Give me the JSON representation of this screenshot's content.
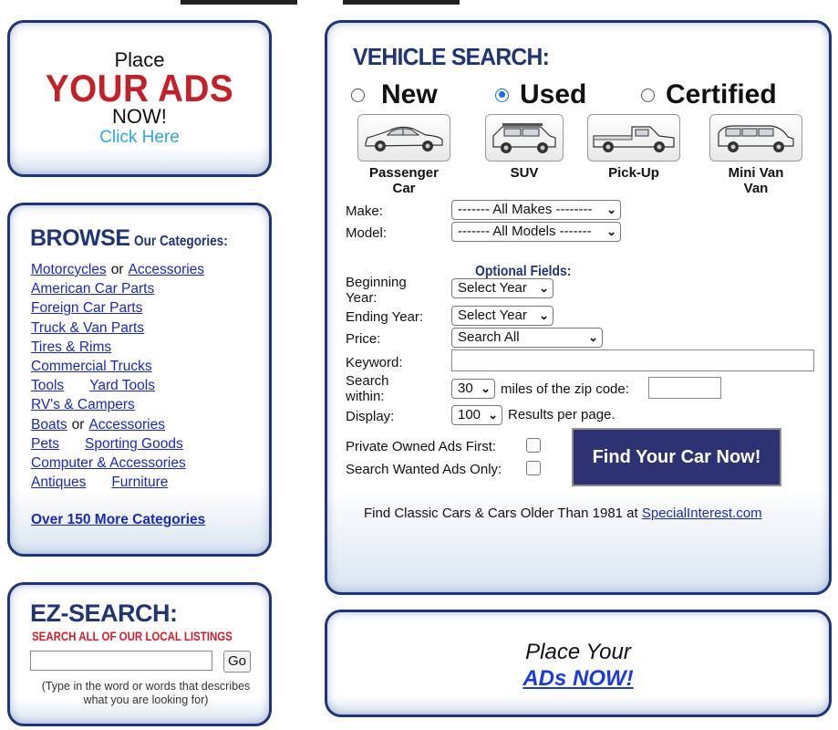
{
  "place_ads": {
    "place": "Place",
    "your_ads": "YOUR ADS",
    "now": "NOW!",
    "click": "Click Here"
  },
  "browse": {
    "title_big": "BROWSE",
    "title_small": "Our Categories:",
    "rows": [
      {
        "items": [
          "Motorcycles",
          "Accessories"
        ],
        "sep": "or"
      },
      {
        "items": [
          "American Car Parts"
        ]
      },
      {
        "items": [
          "Foreign Car Parts"
        ]
      },
      {
        "items": [
          "Truck & Van Parts"
        ]
      },
      {
        "items": [
          "Tires & Rims"
        ]
      },
      {
        "items": [
          "Commercial Trucks"
        ]
      },
      {
        "items": [
          "Tools",
          "Yard Tools"
        ]
      },
      {
        "items": [
          "RV's & Campers"
        ]
      },
      {
        "items": [
          "Boats",
          "Accessories"
        ],
        "sep": "or"
      },
      {
        "items": [
          "Pets",
          "Sporting Goods"
        ]
      },
      {
        "items": [
          "Computer & Accessories"
        ]
      },
      {
        "items": [
          "Antiques",
          "Furniture"
        ]
      }
    ],
    "more": "Over 150 More Categories"
  },
  "ez": {
    "title": "EZ-SEARCH:",
    "subtitle": "SEARCH ALL OF OUR LOCAL LISTINGS",
    "input_value": "",
    "go": "Go",
    "help": "(Type in the word or words that describes what you are looking for)"
  },
  "vehicle_search": {
    "title": "VEHICLE SEARCH:",
    "conditions": [
      {
        "label": "New",
        "selected": false
      },
      {
        "label": "Used",
        "selected": true
      },
      {
        "label": "Certified",
        "selected": false
      }
    ],
    "types": [
      {
        "label": "Passenger Car",
        "icon": "sedan-icon"
      },
      {
        "label": "SUV",
        "icon": "suv-icon"
      },
      {
        "label": "Pick-Up",
        "icon": "pickup-truck-icon"
      },
      {
        "label": "Mini Van Van",
        "icon": "minivan-icon"
      }
    ],
    "make_label": "Make:",
    "make_value": "------- All Makes --------",
    "model_label": "Model:",
    "model_value": "------- All Models -------",
    "optional": "Optional Fields:",
    "begin_year_label": "Beginning Year:",
    "begin_year_value": "Select Year",
    "end_year_label": "Ending Year:",
    "end_year_value": "Select Year",
    "price_label": "Price:",
    "price_value": "Search All",
    "keyword_label": "Keyword:",
    "keyword_value": "",
    "within_label": "Search within:",
    "within_value": "30",
    "miles_text": "miles of the zip code:",
    "zip_value": "",
    "display_label": "Display:",
    "display_value": "100",
    "results_text": "Results per page.",
    "private_label": "Private Owned Ads First:",
    "wanted_label": "Search Wanted Ads Only:",
    "find_button": "Find Your Car Now!",
    "classic_text": "Find Classic Cars & Cars Older Than 1981 at",
    "classic_link": "SpecialInterest.com"
  },
  "place_ads_2": {
    "line1": "Place Your",
    "line2": "ADs NOW!"
  }
}
